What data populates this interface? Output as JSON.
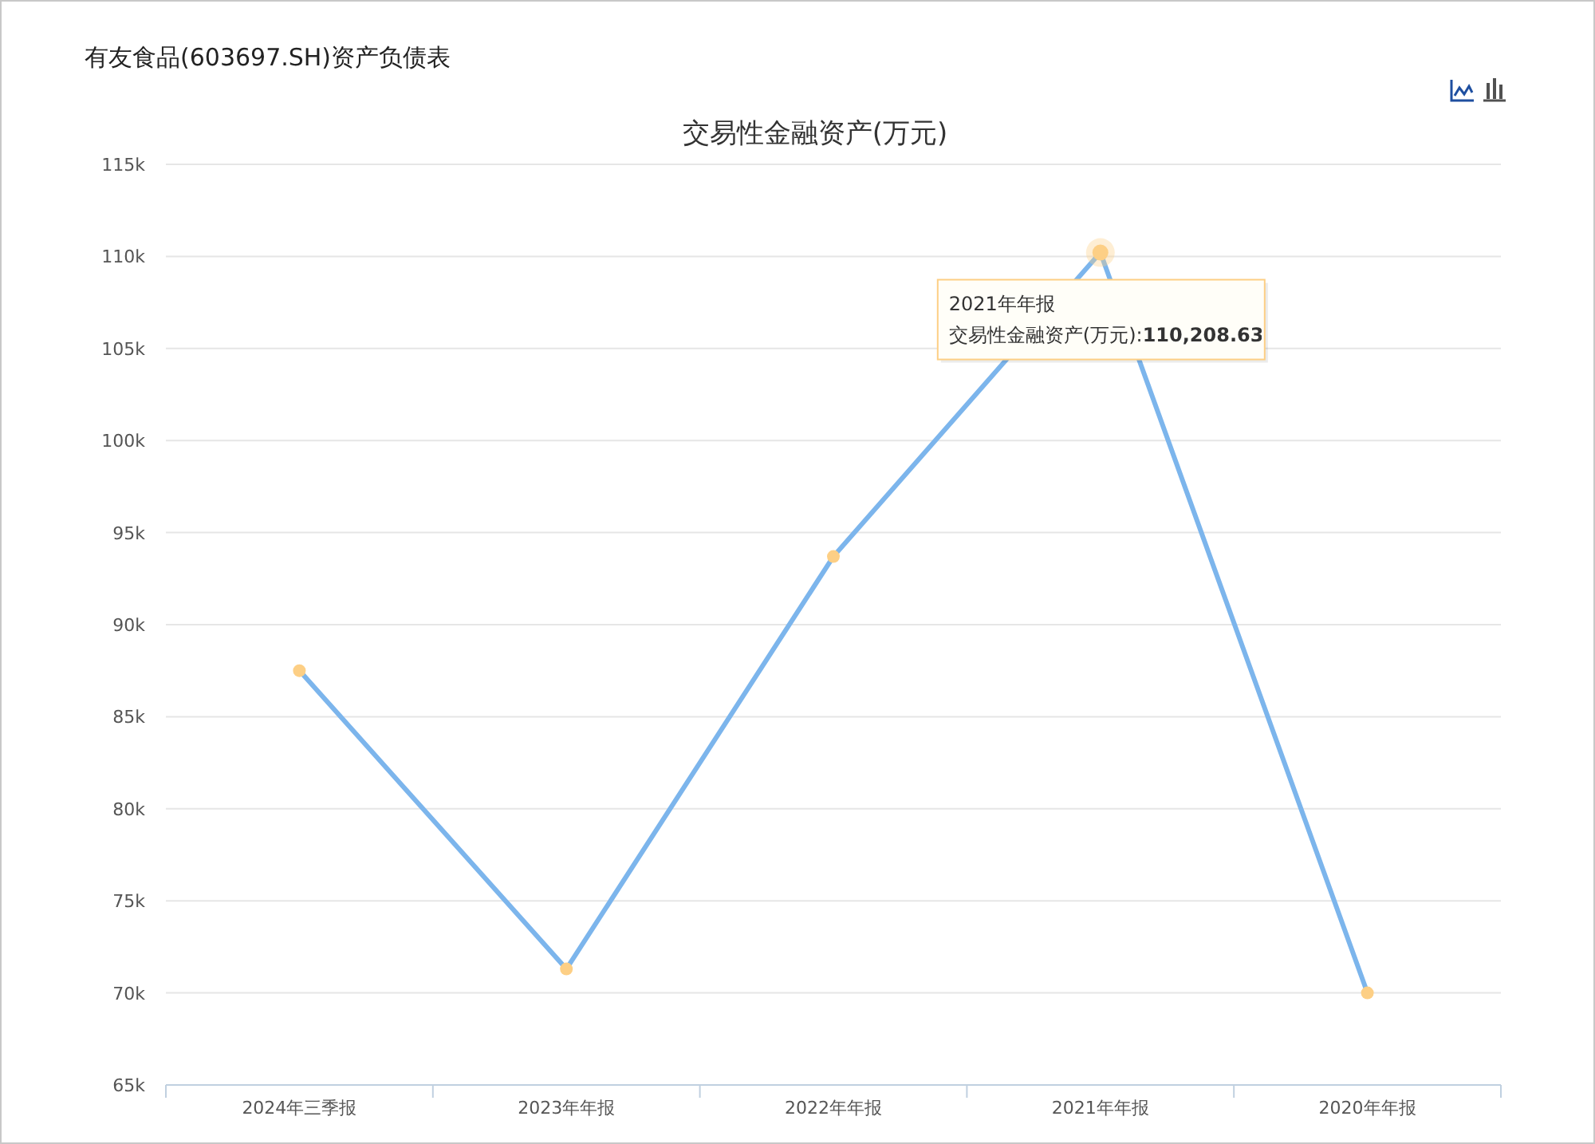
{
  "title": "有友食品(603697.SH)资产负债表",
  "toolbar": {
    "buttons": [
      {
        "kind": "line",
        "selected": true
      },
      {
        "kind": "bar",
        "selected": false
      }
    ]
  },
  "chart_data": {
    "type": "line",
    "title": "交易性金融资产(万元)",
    "categories": [
      "2024年三季报",
      "2023年年报",
      "2022年年报",
      "2021年年报",
      "2020年年报"
    ],
    "series": [
      {
        "name": "交易性金融资产(万元)",
        "color": "#7cb5ec",
        "marker": true,
        "values": [
          87500,
          71300,
          93700,
          110208.63,
          70000
        ]
      }
    ],
    "ylim": [
      65000,
      115000
    ],
    "yticks": [
      {
        "value": 65000,
        "label": "65k"
      },
      {
        "value": 70000,
        "label": "70k"
      },
      {
        "value": 75000,
        "label": "75k"
      },
      {
        "value": 80000,
        "label": "80k"
      },
      {
        "value": 85000,
        "label": "85k"
      },
      {
        "value": 90000,
        "label": "90k"
      },
      {
        "value": 95000,
        "label": "95k"
      },
      {
        "value": 100000,
        "label": "100k"
      },
      {
        "value": 105000,
        "label": "105k"
      },
      {
        "value": 110000,
        "label": "110k"
      },
      {
        "value": 115000,
        "label": "115k"
      }
    ],
    "grid": true
  },
  "tooltip": {
    "title": "2021年年报",
    "value": ":**110,208.63**"
  }
}
